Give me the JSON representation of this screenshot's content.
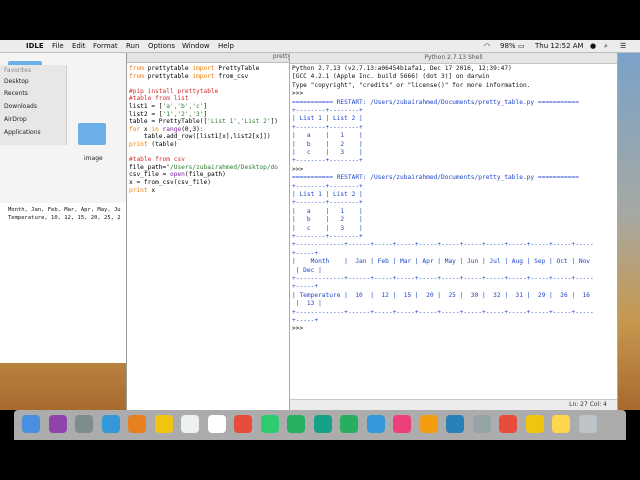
{
  "menubar": {
    "apple": "",
    "app": "IDLE",
    "items": [
      "File",
      "Edit",
      "Format",
      "Run",
      "Options",
      "Window",
      "Help"
    ],
    "battery": "98%",
    "clock": "Thu 12:52 AM"
  },
  "finder": {
    "favorites_label": "Favorites",
    "sidebar": [
      "Desktop",
      "Recents",
      "Downloads",
      "AirDrop",
      "Applications"
    ],
    "folder_label": "image"
  },
  "text_window": {
    "lines": [
      "Month, Jan, Feb, Mar, Apr, May, Ju",
      "Temperature, 10, 12, 15, 20, 25, 2"
    ]
  },
  "editor": {
    "title": "pretty",
    "lines": [
      [
        {
          "t": "from ",
          "c": "kw"
        },
        {
          "t": "prettytable ",
          "c": "df"
        },
        {
          "t": "import ",
          "c": "kw"
        },
        {
          "t": "PrettyTable",
          "c": "df"
        }
      ],
      [
        {
          "t": "from ",
          "c": "kw"
        },
        {
          "t": "prettytable ",
          "c": "df"
        },
        {
          "t": "import ",
          "c": "kw"
        },
        {
          "t": "from_csv",
          "c": "df"
        }
      ],
      [
        {
          "t": "",
          "c": "df"
        }
      ],
      [
        {
          "t": "#pip install prettytable",
          "c": "cm"
        }
      ],
      [
        {
          "t": "#table from list",
          "c": "cm"
        }
      ],
      [
        {
          "t": "list1 = [",
          "c": "df"
        },
        {
          "t": "'a','b','c'",
          "c": "st"
        },
        {
          "t": "]",
          "c": "df"
        }
      ],
      [
        {
          "t": "list2 = [",
          "c": "df"
        },
        {
          "t": "'1','2','3'",
          "c": "st"
        },
        {
          "t": "]",
          "c": "df"
        }
      ],
      [
        {
          "t": "table = PrettyTable([",
          "c": "df"
        },
        {
          "t": "'List 1','List 2'",
          "c": "st"
        },
        {
          "t": "])",
          "c": "df"
        }
      ],
      [
        {
          "t": "for ",
          "c": "kw"
        },
        {
          "t": "x ",
          "c": "df"
        },
        {
          "t": "in ",
          "c": "kw"
        },
        {
          "t": "range",
          "c": "bi"
        },
        {
          "t": "(0,3):",
          "c": "df"
        }
      ],
      [
        {
          "t": "    table.add_row([list1[x],list2[x]])",
          "c": "df"
        }
      ],
      [
        {
          "t": "print ",
          "c": "kw"
        },
        {
          "t": "(table)",
          "c": "df"
        }
      ],
      [
        {
          "t": "",
          "c": "df"
        }
      ],
      [
        {
          "t": "#table from csv",
          "c": "cm"
        }
      ],
      [
        {
          "t": "file_path=",
          "c": "df"
        },
        {
          "t": "\"/Users/zubairahmed/Desktop/do",
          "c": "st"
        }
      ],
      [
        {
          "t": "csv_file = ",
          "c": "df"
        },
        {
          "t": "open",
          "c": "bi"
        },
        {
          "t": "(file_path)",
          "c": "df"
        }
      ],
      [
        {
          "t": "x = from_csv(csv_file)",
          "c": "df"
        }
      ],
      [
        {
          "t": "print ",
          "c": "kw"
        },
        {
          "t": "x",
          "c": "df"
        }
      ]
    ]
  },
  "shell": {
    "title": "Python 2.7.13 Shell",
    "lines": [
      {
        "t": "Python 2.7.13 (v2.7.13:a06454b1afa1, Dec 17 2016, 12:39:47)",
        "c": "black"
      },
      {
        "t": "[GCC 4.2.1 (Apple Inc. build 5666) (dot 3)] on darwin",
        "c": "black"
      },
      {
        "t": "Type \"copyright\", \"credits\" or \"license()\" for more information.",
        "c": "black"
      },
      {
        "t": ">>> ",
        "c": "black"
      },
      {
        "t": "=========== RESTART: /Users/zubairahmed/Documents/pretty_table.py ===========",
        "c": "blue"
      },
      {
        "t": "+--------+--------+",
        "c": "blue"
      },
      {
        "t": "| List 1 | List 2 |",
        "c": "blue"
      },
      {
        "t": "+--------+--------+",
        "c": "blue"
      },
      {
        "t": "|   a    |   1    |",
        "c": "blue"
      },
      {
        "t": "|   b    |   2    |",
        "c": "blue"
      },
      {
        "t": "|   c    |   3    |",
        "c": "blue"
      },
      {
        "t": "+--------+--------+",
        "c": "blue"
      },
      {
        "t": ">>> ",
        "c": "black"
      },
      {
        "t": "=========== RESTART: /Users/zubairahmed/Documents/pretty_table.py ===========",
        "c": "blue"
      },
      {
        "t": "+--------+--------+",
        "c": "blue"
      },
      {
        "t": "| List 1 | List 2 |",
        "c": "blue"
      },
      {
        "t": "+--------+--------+",
        "c": "blue"
      },
      {
        "t": "|   a    |   1    |",
        "c": "blue"
      },
      {
        "t": "|   b    |   2    |",
        "c": "blue"
      },
      {
        "t": "|   c    |   3    |",
        "c": "blue"
      },
      {
        "t": "+--------+--------+",
        "c": "blue"
      },
      {
        "t": "+-------------+------+-----+-----+-----+-----+-----+-----+-----+-----+-----+-----",
        "c": "blue"
      },
      {
        "t": "+-----+",
        "c": "blue"
      },
      {
        "t": "|    Month    |  Jan | Feb | Mar | Apr | May | Jun | Jul | Aug | Sep | Oct | Nov",
        "c": "blue"
      },
      {
        "t": " | Dec |",
        "c": "blue"
      },
      {
        "t": "+-------------+------+-----+-----+-----+-----+-----+-----+-----+-----+-----+-----",
        "c": "blue"
      },
      {
        "t": "+-----+",
        "c": "blue"
      },
      {
        "t": "| Temperature |  10  |  12 |  15 |  20 |  25 |  30 |  32 |  31 |  29 |  26 |  16",
        "c": "blue"
      },
      {
        "t": " |  13 |",
        "c": "blue"
      },
      {
        "t": "+-------------+------+-----+-----+-----+-----+-----+-----+-----+-----+-----+-----",
        "c": "blue"
      },
      {
        "t": "+-----+",
        "c": "blue"
      },
      {
        "t": ">>> ",
        "c": "black"
      }
    ],
    "status": "Ln: 27   Col: 4"
  },
  "colors": {
    "keyword": "#f57c00",
    "comment": "#d32f2f",
    "string": "#2e7d32",
    "builtin": "#7b1fa2",
    "shell_output": "#1f44c8"
  },
  "dock": {
    "icons": [
      "finder-icon",
      "siri-icon",
      "launchpad-icon",
      "safari-icon",
      "photos-app-icon",
      "notes-icon",
      "calendar-icon",
      "reminders-icon",
      "photos-icon",
      "messages-icon",
      "facetime-icon",
      "maps-icon",
      "numbers-icon",
      "keynote-icon",
      "itunes-icon",
      "ibooks-icon",
      "app-store-icon",
      "system-preferences-icon",
      "chrome-icon",
      "python-icon",
      "idle-icon",
      "trash-icon"
    ]
  }
}
